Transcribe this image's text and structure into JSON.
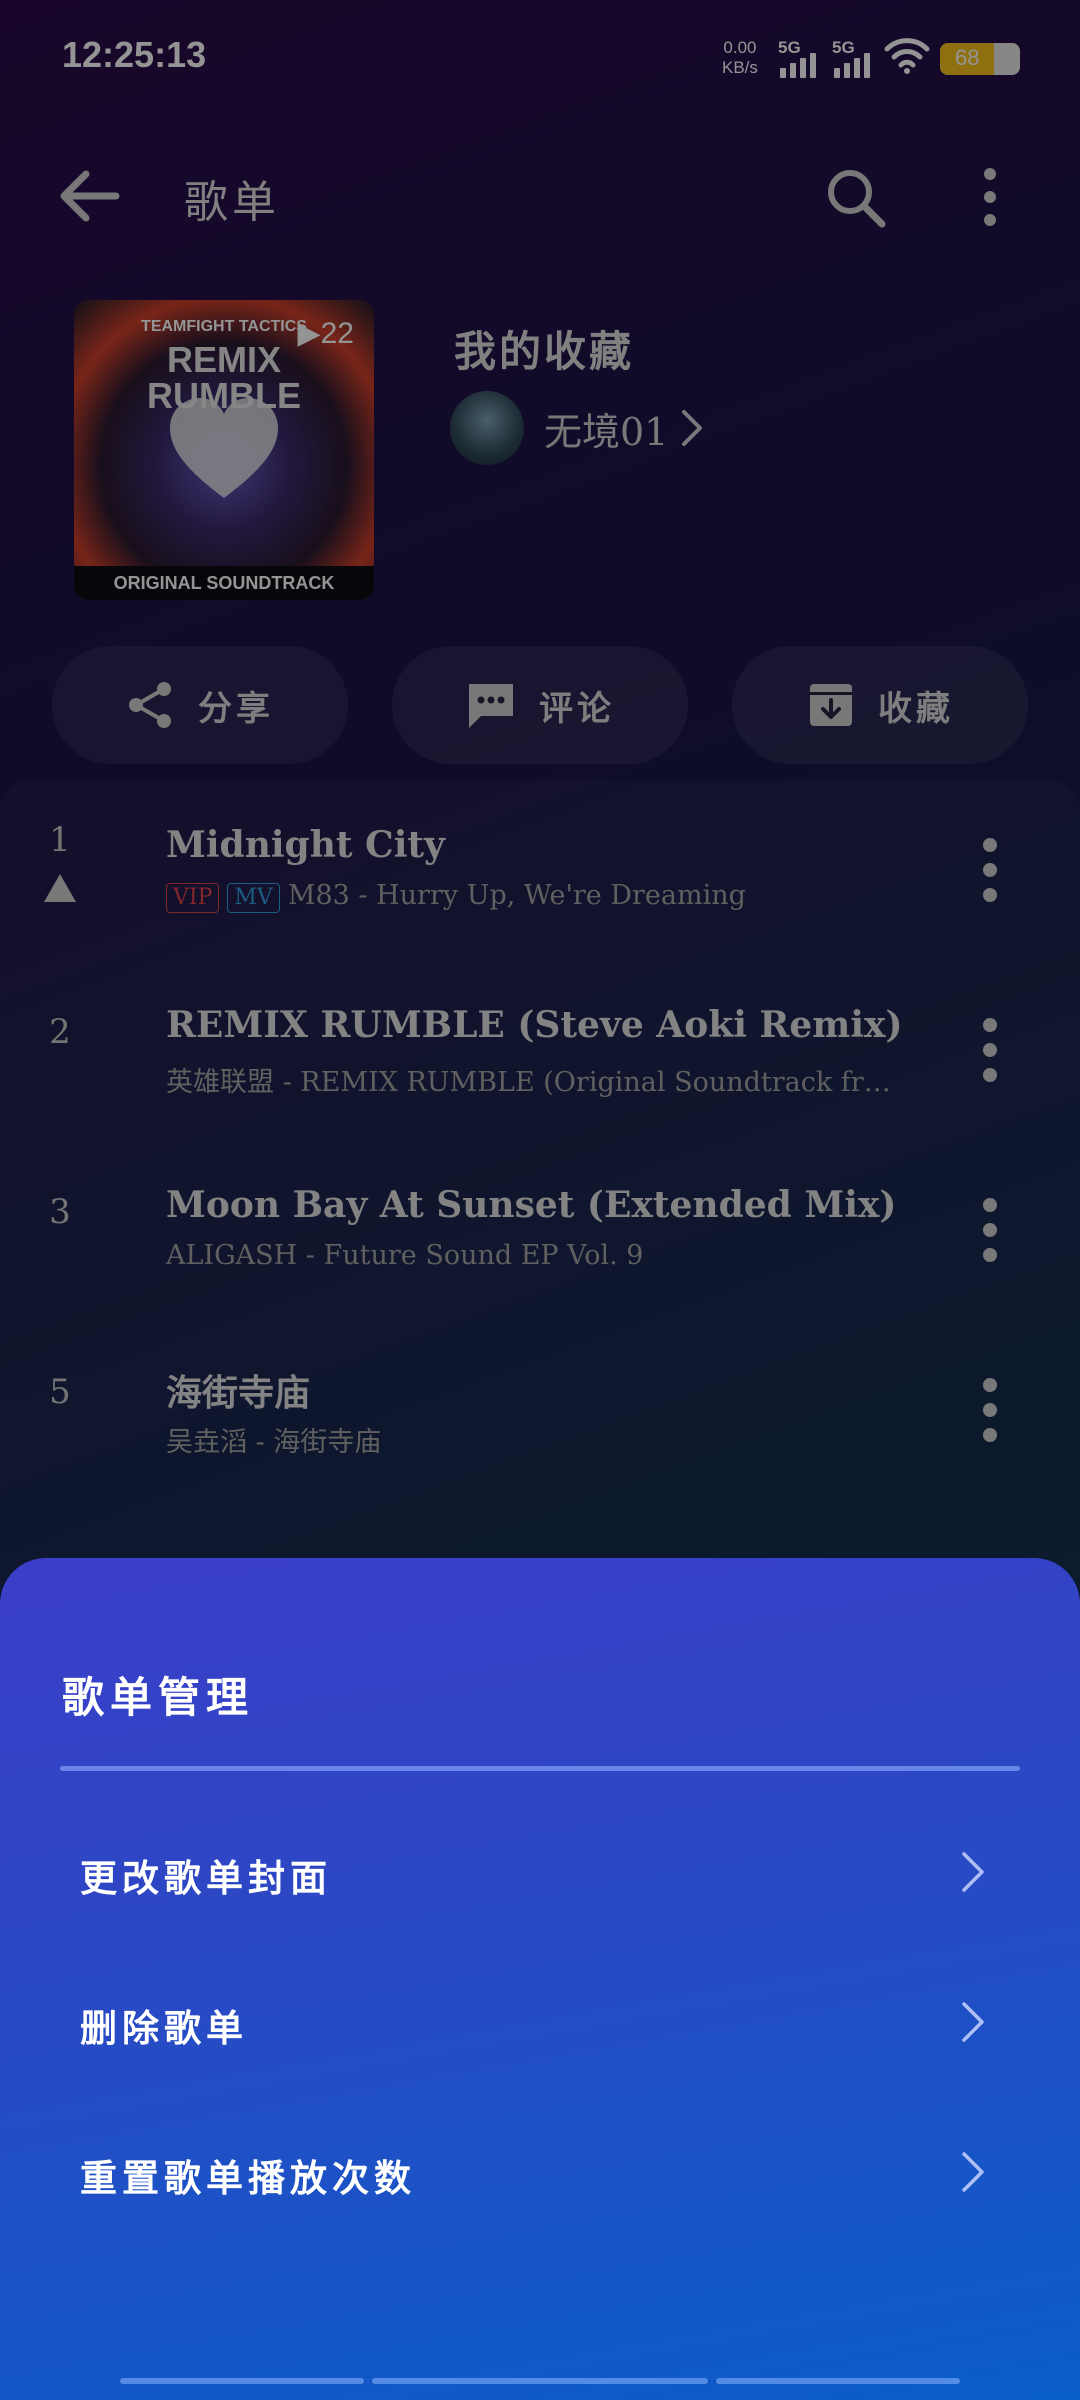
{
  "status_bar": {
    "time": "12:25:13",
    "net_speed_value": "0.00",
    "net_speed_unit": "KB/s",
    "sim1": "5G",
    "sim2": "5G",
    "battery": "68",
    "battery_level": 0.68
  },
  "header": {
    "title": "歌单",
    "back_icon": "arrow-left-icon",
    "search_icon": "search-icon",
    "more_icon": "more-vertical-icon"
  },
  "playlist": {
    "name": "我的收藏",
    "owner": "无境01",
    "play_count": "22",
    "cover_top_text": "TEAMFIGHT TACTICS",
    "cover_title_1": "REMIX",
    "cover_title_2": "RUMBLE",
    "cover_bottom_text": "ORIGINAL SOUNDTRACK"
  },
  "actions": [
    {
      "label": "分享",
      "icon": "share-icon"
    },
    {
      "label": "评论",
      "icon": "comment-icon"
    },
    {
      "label": "收藏",
      "icon": "collect-icon"
    }
  ],
  "songs": [
    {
      "index": "1",
      "title": "Midnight City",
      "tags": [
        "VIP",
        "MV"
      ],
      "artist": "M83",
      "album": "Hurry Up, We're Dreaming",
      "sep": " - "
    },
    {
      "index": "2",
      "title": "REMIX RUMBLE (Steve Aoki Remix)",
      "artist": "英雄联盟",
      "album": "REMIX RUMBLE (Original Soundtrack fr…",
      "sep": " - "
    },
    {
      "index": "3",
      "title": "Moon Bay At Sunset (Extended Mix)",
      "artist": "ALIGASH",
      "album": "Future Sound EP Vol. 9",
      "sep": " - "
    },
    {
      "index": "5",
      "title": "海街寺庙",
      "artist": "吴垚滔",
      "album": "海街寺庙",
      "sep": " - "
    }
  ],
  "sheet": {
    "title": "歌单管理",
    "options": [
      {
        "label": "更改歌单封面",
        "icon": "chevron-right-icon"
      },
      {
        "label": "删除歌单",
        "icon": "chevron-right-icon"
      },
      {
        "label": "重置歌单播放次数",
        "icon": "chevron-right-icon"
      }
    ]
  },
  "colors": {
    "vip": "#e0424a",
    "mv": "#2f9fe0",
    "battery": "#f6c21c",
    "sheet_top": "#3b3ec9",
    "sheet_bottom": "#0a5ec8"
  }
}
